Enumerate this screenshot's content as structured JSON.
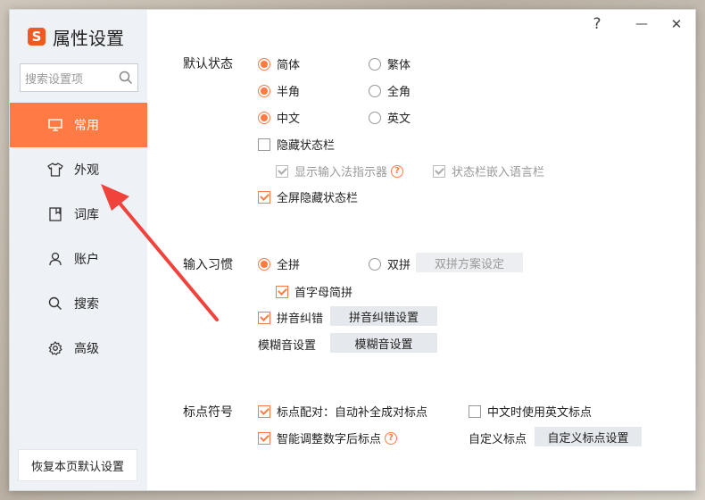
{
  "window": {
    "title": "属性设置",
    "logo_letter": "S",
    "help_symbol": "?",
    "minimize_symbol": "—",
    "close_symbol": "✕"
  },
  "search": {
    "placeholder": "搜索设置项",
    "icon": "search-icon"
  },
  "sidebar": {
    "items": [
      {
        "label": "常用",
        "icon": "monitor-icon",
        "active": true
      },
      {
        "label": "外观",
        "icon": "shirt-icon",
        "active": false
      },
      {
        "label": "词库",
        "icon": "book-icon",
        "active": false
      },
      {
        "label": "账户",
        "icon": "user-icon",
        "active": false
      },
      {
        "label": "搜索",
        "icon": "search-icon",
        "active": false
      },
      {
        "label": "高级",
        "icon": "gear-icon",
        "active": false
      }
    ],
    "reset_label": "恢复本页默认设置"
  },
  "default_state": {
    "label": "默认状态",
    "simplified": "简体",
    "traditional": "繁体",
    "half_width": "半角",
    "full_width": "全角",
    "chinese": "中文",
    "english": "英文",
    "hide_status_bar": "隐藏状态栏",
    "show_indicator": "显示输入法指示器",
    "embed_language_bar": "状态栏嵌入语言栏",
    "fullscreen_hide": "全屏隐藏状态栏"
  },
  "input_habit": {
    "label": "输入习惯",
    "full_pinyin": "全拼",
    "double_pinyin": "双拼",
    "double_pinyin_settings": "双拼方案设定",
    "initial_abbr": "首字母简拼",
    "pinyin_correction": "拼音纠错",
    "pinyin_correction_settings": "拼音纠错设置",
    "fuzzy_label": "模糊音设置",
    "fuzzy_settings": "模糊音设置"
  },
  "punctuation": {
    "label": "标点符号",
    "auto_pair": "标点配对：自动补全成对标点",
    "english_punct_in_chinese": "中文时使用英文标点",
    "smart_adjust": "智能调整数字后标点",
    "custom_label": "自定义标点",
    "custom_settings": "自定义标点设置"
  },
  "accent_color": "#ff7a45"
}
